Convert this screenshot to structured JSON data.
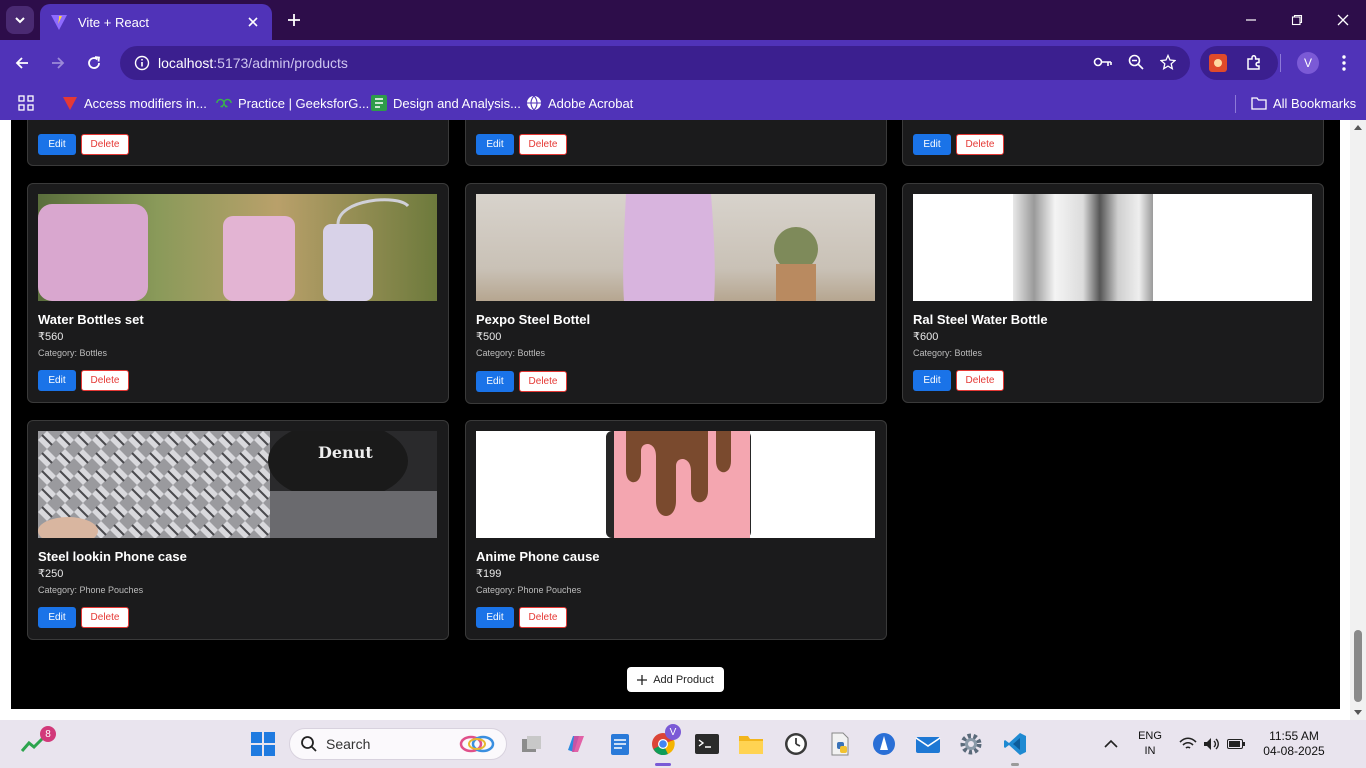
{
  "browser": {
    "tab_title": "Vite + React",
    "url_host": "localhost",
    "url_path": ":5173/admin/products",
    "profile_initial": "V",
    "bookmarks": [
      {
        "label": "Access modifiers in...",
        "icon": "v-logo-icon"
      },
      {
        "label": "Practice | GeeksforG...",
        "icon": "geeksforgeeks-icon"
      },
      {
        "label": "Design and Analysis...",
        "icon": "green-doc-icon"
      },
      {
        "label": "Adobe Acrobat",
        "icon": "globe-icon"
      }
    ],
    "all_bookmarks": "All Bookmarks"
  },
  "products": [
    {
      "name": "Water Bottles set",
      "price": "₹560",
      "category": "Category: Bottles"
    },
    {
      "name": "Pexpo Steel Bottel",
      "price": "₹500",
      "category": "Category: Bottles"
    },
    {
      "name": "Ral Steel Water Bottle",
      "price": "₹600",
      "category": "Category: Bottles"
    },
    {
      "name": "Steel lookin Phone case",
      "price": "₹250",
      "category": "Category: Phone Pouches"
    },
    {
      "name": "Anime Phone cause",
      "price": "₹199",
      "category": "Category: Phone Pouches"
    }
  ],
  "actions": {
    "edit": "Edit",
    "delete": "Delete",
    "add_product": "Add Product"
  },
  "taskbar": {
    "search_placeholder": "Search",
    "notification_count": "8",
    "lang_top": "ENG",
    "lang_bottom": "IN",
    "time": "11:55 AM",
    "date": "04-08-2025"
  },
  "colors": {
    "accent": "#1a73e8",
    "danger": "#e53935",
    "chrome": "#5033b8",
    "page_bg": "#000000"
  }
}
